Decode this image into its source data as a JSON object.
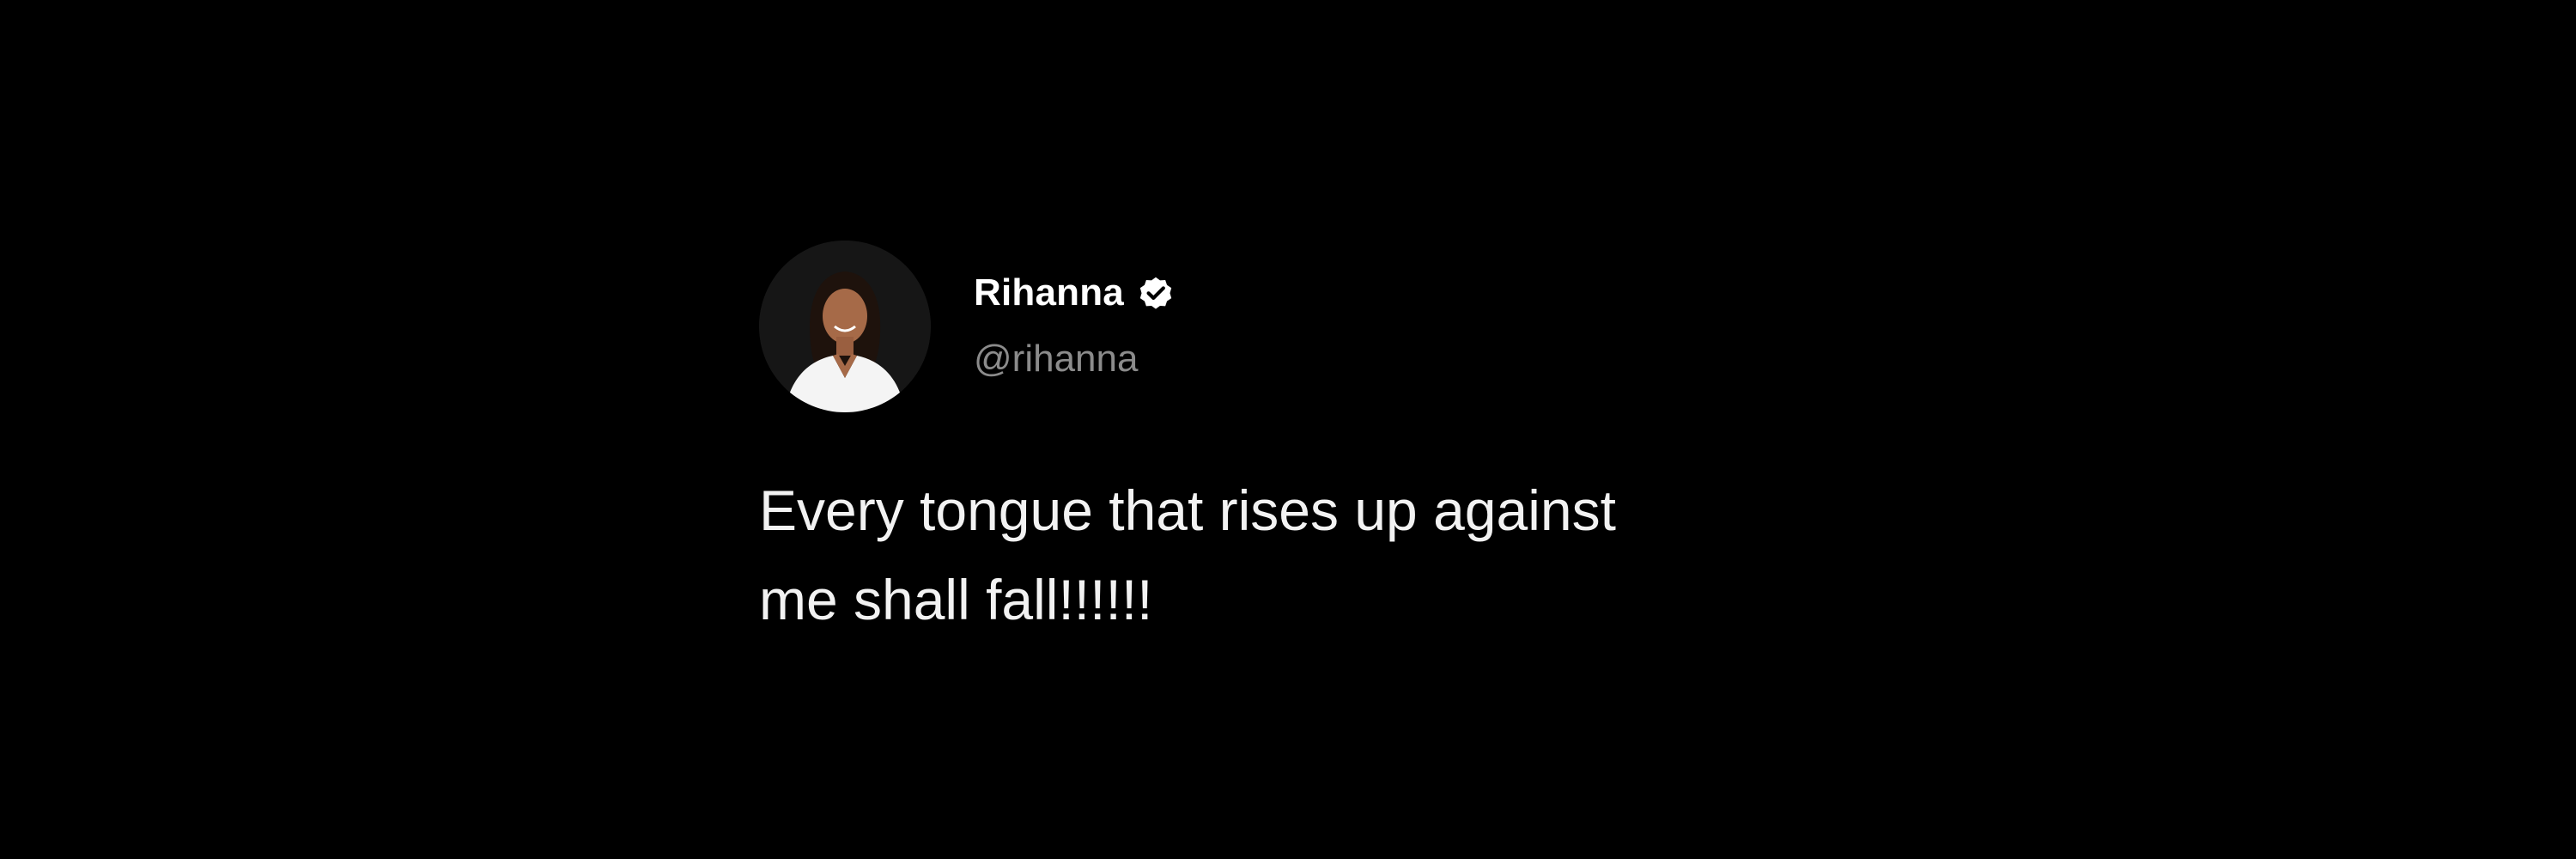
{
  "tweet": {
    "author": {
      "display_name": "Rihanna",
      "handle": "@rihanna",
      "verified": true,
      "avatar_icon": "profile-photo"
    },
    "text_line_1": "Every tongue that rises up against",
    "text_line_2": "me shall fall!!!!!!"
  },
  "colors": {
    "background": "#000000",
    "display_name": "#ffffff",
    "handle": "#8b8b8b",
    "body_text": "#f2f2f2",
    "verified_badge": "#ffffff"
  }
}
